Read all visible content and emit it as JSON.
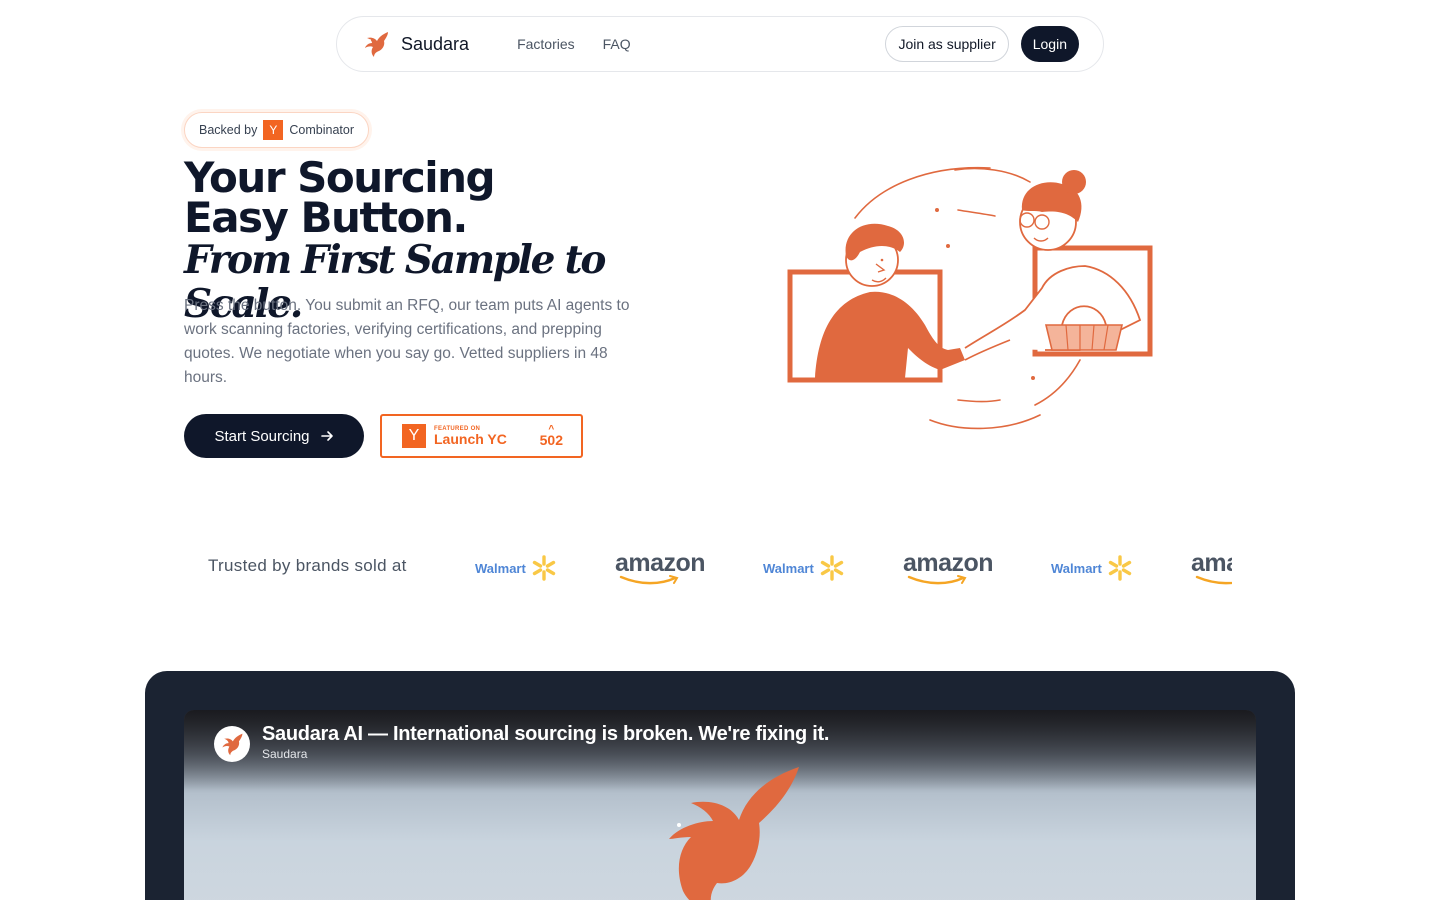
{
  "nav": {
    "brand_name": "Saudara",
    "links": [
      "Factories",
      "FAQ"
    ],
    "join_label": "Join as supplier",
    "login_label": "Login"
  },
  "hero": {
    "badge_prefix": "Backed by",
    "badge_yc": "Y",
    "badge_suffix": "Combinator",
    "title_line1": "Your Sourcing",
    "title_line2": "Easy Button.",
    "title_line3": "From First Sample to Scale.",
    "description": "Press the button. You submit an RFQ, our team puts AI agents to work scanning factories, verifying certifications, and prepping quotes. We negotiate when you say go. Vetted suppliers in 48 hours.",
    "cta_label": "Start Sourcing",
    "launch_yc": {
      "logo": "Y",
      "featured": "FEATURED ON",
      "label": "Launch YC",
      "votes": "502"
    }
  },
  "trusted": {
    "label": "Trusted by brands sold at",
    "logos": [
      "Walmart",
      "amazon",
      "Walmart",
      "amazon",
      "Walmart",
      "amazon"
    ]
  },
  "video": {
    "title": "Saudara AI — International sourcing is broken. We're fixing it.",
    "channel": "Saudara"
  },
  "colors": {
    "accent": "#f26522",
    "illustration": "#e0693f",
    "dark": "#0f172a",
    "walmart_blue": "#4f86d6",
    "walmart_spark": "#f9c846"
  },
  "icons": [
    "phoenix-logo-icon",
    "arrow-right-icon",
    "handshake-illustration",
    "walmart-spark-icon",
    "amazon-smile-icon"
  ]
}
